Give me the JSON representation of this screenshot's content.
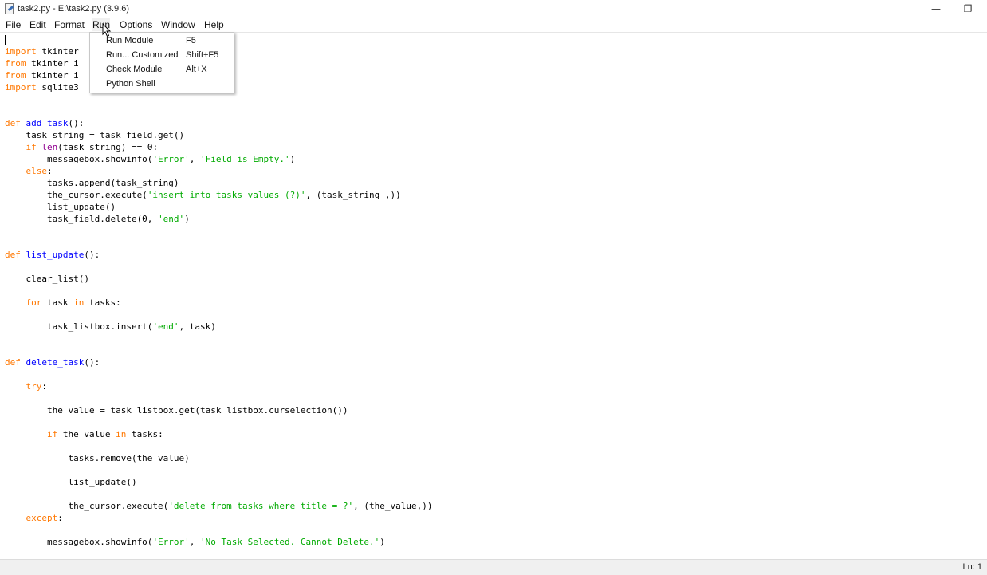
{
  "window": {
    "title": "task2.py - E:\\task2.py (3.9.6)",
    "minimize_glyph": "—",
    "restore_glyph": "❐"
  },
  "menubar": {
    "items": [
      "File",
      "Edit",
      "Format",
      "Run",
      "Options",
      "Window",
      "Help"
    ],
    "open_menu": "Run"
  },
  "run_menu": {
    "items": [
      {
        "label": "Run Module",
        "accel": "F5"
      },
      {
        "label": "Run... Customized",
        "accel": "Shift+F5"
      },
      {
        "label": "Check Module",
        "accel": "Alt+X"
      },
      {
        "label": "Python Shell",
        "accel": ""
      }
    ]
  },
  "editor": {
    "lines": [
      [
        [
          "kw",
          "import"
        ],
        [
          "t",
          " tkinter"
        ]
      ],
      [
        [
          "kw",
          "from"
        ],
        [
          "t",
          " tkinter i"
        ]
      ],
      [
        [
          "kw",
          "from"
        ],
        [
          "t",
          " tkinter i"
        ]
      ],
      [
        [
          "kw",
          "import"
        ],
        [
          "t",
          " sqlite3"
        ]
      ],
      [],
      [],
      [
        [
          "kw",
          "def"
        ],
        [
          "t",
          " "
        ],
        [
          "fn",
          "add_task"
        ],
        [
          "t",
          "():"
        ]
      ],
      [
        [
          "t",
          "    task_string = task_field.get()"
        ]
      ],
      [
        [
          "t",
          "    "
        ],
        [
          "kw",
          "if"
        ],
        [
          "t",
          " "
        ],
        [
          "bi",
          "len"
        ],
        [
          "t",
          "(task_string) == 0:"
        ]
      ],
      [
        [
          "t",
          "        messagebox.showinfo("
        ],
        [
          "str",
          "'Error'"
        ],
        [
          "t",
          ", "
        ],
        [
          "str",
          "'Field is Empty.'"
        ],
        [
          "t",
          ")"
        ]
      ],
      [
        [
          "t",
          "    "
        ],
        [
          "kw",
          "else"
        ],
        [
          "t",
          ":"
        ]
      ],
      [
        [
          "t",
          "        tasks.append(task_string)"
        ]
      ],
      [
        [
          "t",
          "        the_cursor.execute("
        ],
        [
          "str",
          "'insert into tasks values (?)'"
        ],
        [
          "t",
          ", (task_string ,))"
        ]
      ],
      [
        [
          "t",
          "        list_update()"
        ]
      ],
      [
        [
          "t",
          "        task_field.delete(0, "
        ],
        [
          "str",
          "'end'"
        ],
        [
          "t",
          ")"
        ]
      ],
      [],
      [],
      [
        [
          "kw",
          "def"
        ],
        [
          "t",
          " "
        ],
        [
          "fn",
          "list_update"
        ],
        [
          "t",
          "():"
        ]
      ],
      [],
      [
        [
          "t",
          "    clear_list()"
        ]
      ],
      [],
      [
        [
          "t",
          "    "
        ],
        [
          "kw",
          "for"
        ],
        [
          "t",
          " task "
        ],
        [
          "kw",
          "in"
        ],
        [
          "t",
          " tasks:"
        ]
      ],
      [],
      [
        [
          "t",
          "        task_listbox.insert("
        ],
        [
          "str",
          "'end'"
        ],
        [
          "t",
          ", task)"
        ]
      ],
      [],
      [],
      [
        [
          "kw",
          "def"
        ],
        [
          "t",
          " "
        ],
        [
          "fn",
          "delete_task"
        ],
        [
          "t",
          "():"
        ]
      ],
      [],
      [
        [
          "t",
          "    "
        ],
        [
          "kw",
          "try"
        ],
        [
          "t",
          ":"
        ]
      ],
      [],
      [
        [
          "t",
          "        the_value = task_listbox.get(task_listbox.curselection())"
        ]
      ],
      [],
      [
        [
          "t",
          "        "
        ],
        [
          "kw",
          "if"
        ],
        [
          "t",
          " the_value "
        ],
        [
          "kw",
          "in"
        ],
        [
          "t",
          " tasks:"
        ]
      ],
      [],
      [
        [
          "t",
          "            tasks.remove(the_value)"
        ]
      ],
      [],
      [
        [
          "t",
          "            list_update()"
        ]
      ],
      [],
      [
        [
          "t",
          "            the_cursor.execute("
        ],
        [
          "str",
          "'delete from tasks where title = ?'"
        ],
        [
          "t",
          ", (the_value,))"
        ]
      ],
      [
        [
          "t",
          "    "
        ],
        [
          "kw",
          "except"
        ],
        [
          "t",
          ":"
        ]
      ],
      [],
      [
        [
          "t",
          "        messagebox.showinfo("
        ],
        [
          "str",
          "'Error'"
        ],
        [
          "t",
          ", "
        ],
        [
          "str",
          "'No Task Selected. Cannot Delete.'"
        ],
        [
          "t",
          ")"
        ]
      ]
    ]
  },
  "status": {
    "line": "Ln: 1"
  },
  "colors": {
    "keyword": "#ff7700",
    "definition": "#0000ff",
    "string": "#00aa00",
    "builtin": "#900090"
  }
}
